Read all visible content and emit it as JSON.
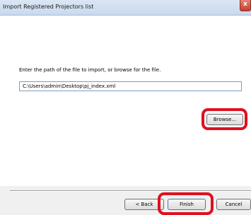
{
  "window": {
    "title": "Import Registered Projectors list",
    "close_symbol": "x"
  },
  "form": {
    "instruction": "Enter the path of the file to import, or browse for the file.",
    "path_value": "C:\\Users\\admin\\Desktop\\pj_index.xml",
    "browse_label": "Browse..."
  },
  "footer": {
    "back_label": "< Back",
    "finish_label": "Finish",
    "cancel_label": "Cancel"
  },
  "colors": {
    "highlight": "#e0101e",
    "titlebar": "#c9d9ee"
  }
}
